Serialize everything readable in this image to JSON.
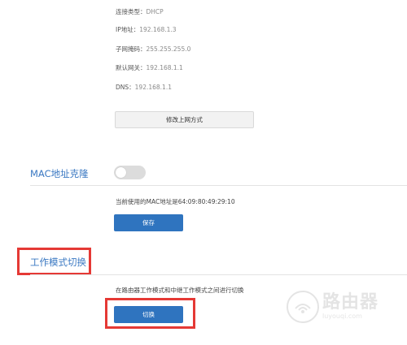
{
  "wan_info": {
    "connection_type_label": "连接类型：",
    "connection_type_value": "DHCP",
    "ip_label": "IP地址：",
    "ip_value": "192.168.1.3",
    "mask_label": "子网掩码：",
    "mask_value": "255.255.255.0",
    "gateway_label": "默认网关：",
    "gateway_value": "192.168.1.1",
    "dns_label": "DNS：",
    "dns_value": "192.168.1.1",
    "change_button_label": "修改上网方式"
  },
  "mac_clone": {
    "title": "MAC地址克隆",
    "toggle_on": false,
    "current_mac_text": "当前使用的MAC地址是64:09:80:49:29:10",
    "save_button_label": "保存"
  },
  "work_mode": {
    "title": "工作模式切换",
    "description": "在路由器工作模式和中继工作模式之间进行切换",
    "switch_button_label": "切换"
  },
  "watermark": {
    "title": "路由器",
    "url": "luyouqi.com"
  },
  "colors": {
    "accent_blue": "#2f74bf",
    "title_blue": "#3a78c2",
    "highlight_red": "#e53935",
    "toggle_off": "#dcdcdc"
  }
}
